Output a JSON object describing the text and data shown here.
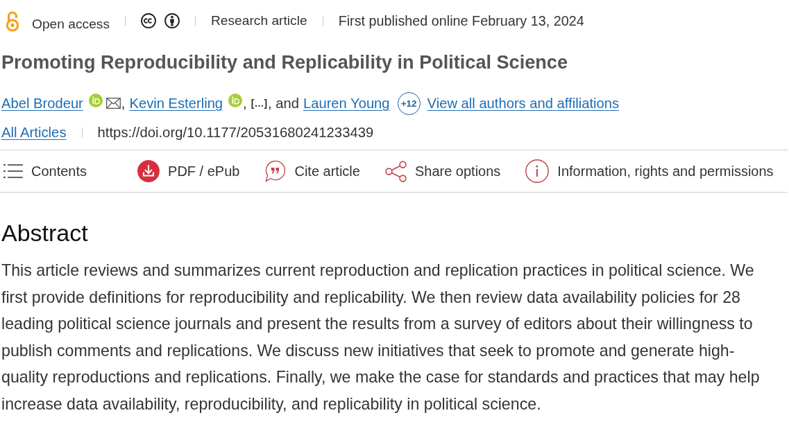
{
  "meta_bar": {
    "access": "Open access",
    "article_type": "Research article",
    "published": "First published online February 13, 2024"
  },
  "title": "Promoting Reproducibility and Replicability in Political Science",
  "byline": [
    {
      "kind": "author",
      "name": "Abel Brodeur",
      "orcid": true,
      "email": true
    },
    {
      "kind": "text",
      "text": ","
    },
    {
      "kind": "author",
      "name": "Kevin Esterling",
      "orcid": true,
      "email": false
    },
    {
      "kind": "text",
      "text": ","
    },
    {
      "kind": "omitted",
      "text": "[…]"
    },
    {
      "kind": "text",
      "text": ", and"
    },
    {
      "kind": "author",
      "name": "Lauren Young",
      "orcid": false,
      "email": false
    },
    {
      "kind": "count",
      "text": "+12"
    },
    {
      "kind": "link",
      "text": "View all authors and affiliations"
    }
  ],
  "doi_row": {
    "collection": "All Articles",
    "doi": "https://doi.org/10.1177/20531680241233439"
  },
  "toolbar": [
    {
      "kind": "contents",
      "label": "Contents"
    },
    {
      "kind": "pdf",
      "label": "PDF / ePub"
    },
    {
      "kind": "cite",
      "label": "Cite article"
    },
    {
      "kind": "share",
      "label": "Share options"
    },
    {
      "kind": "info",
      "label": "Information, rights and permissions"
    }
  ],
  "abstract": {
    "heading": "Abstract",
    "text": "This article reviews and summarizes current reproduction and replication practices in political science. We first provide definitions for reproducibility and replicability. We then review data availability policies for 28 leading political science journals and present the results from a survey of editors about their willingness to publish comments and replications. We discuss new initiatives that seek to promote and generate high-quality reproductions and replications. Finally, we make the case for standards and practices that may help increase data availability, reproducibility, and replicability in political science."
  }
}
